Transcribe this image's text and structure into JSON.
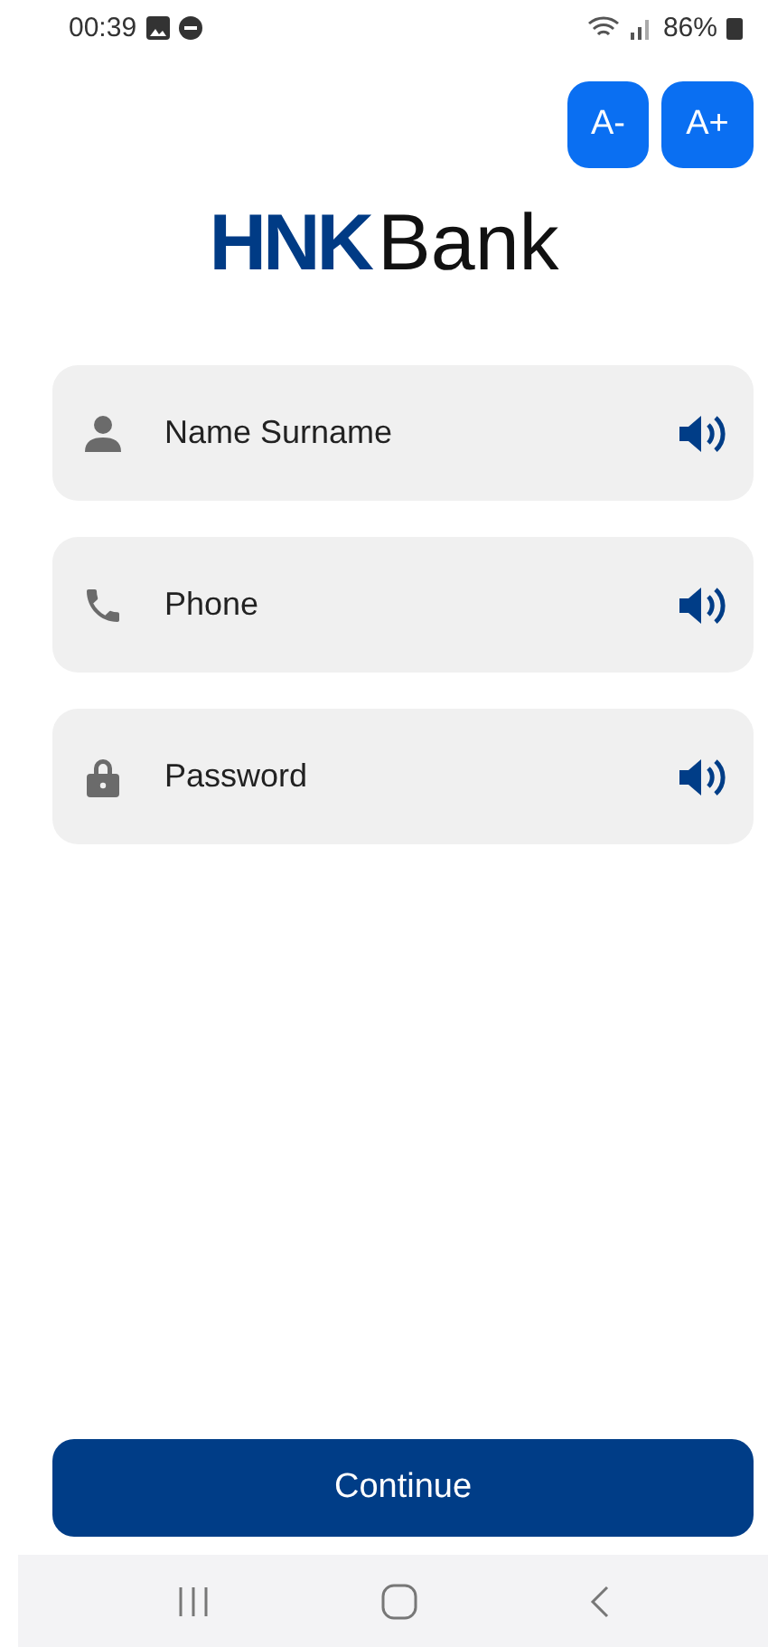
{
  "status_bar": {
    "time": "00:39",
    "battery": "86%"
  },
  "font_buttons": [
    "A-",
    "A+"
  ],
  "logo": {
    "primary": "HNK",
    "secondary": "Bank"
  },
  "fields": [
    {
      "kind": "person",
      "placeholder": "Name Surname"
    },
    {
      "kind": "phone",
      "placeholder": "Phone"
    },
    {
      "kind": "lock",
      "placeholder": "Password"
    }
  ],
  "continue_button": "Continue"
}
